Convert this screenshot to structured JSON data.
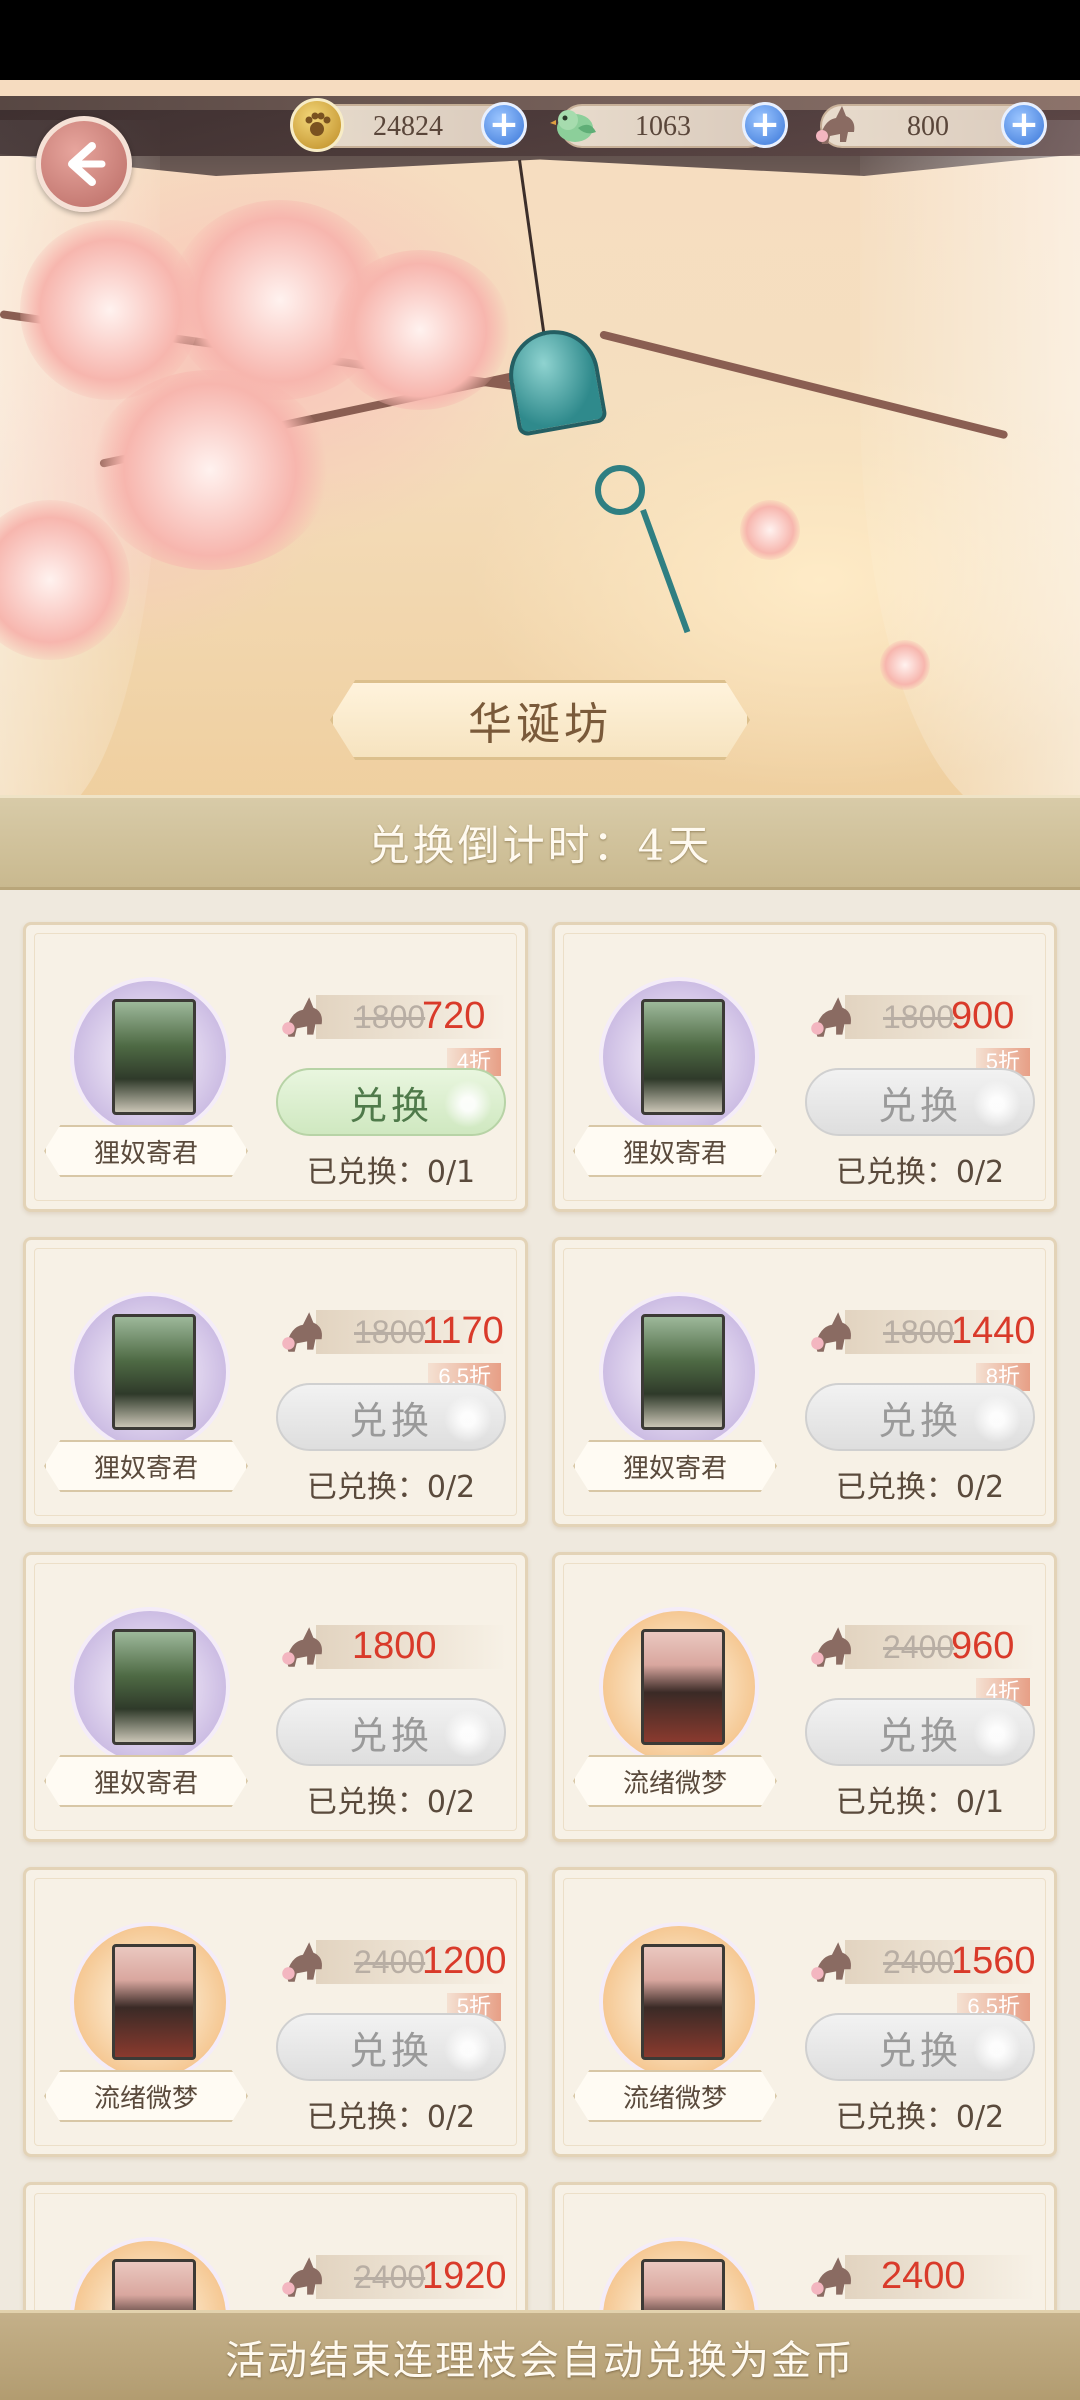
{
  "currencies": [
    {
      "icon": "paw-coin-icon",
      "value": "24824"
    },
    {
      "icon": "green-bird-icon",
      "value": "1063"
    },
    {
      "icon": "horse-token-icon",
      "value": "800"
    }
  ],
  "title": "华诞坊",
  "countdown": "兑换倒计时：4天",
  "items": [
    {
      "name": "狸奴寄君",
      "old_price": "1800",
      "price": "720",
      "discount": "4折",
      "button": "兑换",
      "button_state": "active",
      "redeemed": "已兑换：0/1",
      "theme": "purple"
    },
    {
      "name": "狸奴寄君",
      "old_price": "1800",
      "price": "900",
      "discount": "5折",
      "button": "兑换",
      "button_state": "disabled",
      "redeemed": "已兑换：0/2",
      "theme": "purple"
    },
    {
      "name": "狸奴寄君",
      "old_price": "1800",
      "price": "1170",
      "discount": "6.5折",
      "button": "兑换",
      "button_state": "disabled",
      "redeemed": "已兑换：0/2",
      "theme": "purple"
    },
    {
      "name": "狸奴寄君",
      "old_price": "1800",
      "price": "1440",
      "discount": "8折",
      "button": "兑换",
      "button_state": "disabled",
      "redeemed": "已兑换：0/2",
      "theme": "purple"
    },
    {
      "name": "狸奴寄君",
      "old_price": "",
      "price": "1800",
      "discount": "",
      "button": "兑换",
      "button_state": "disabled",
      "redeemed": "已兑换：0/2",
      "theme": "purple"
    },
    {
      "name": "流绪微梦",
      "old_price": "2400",
      "price": "960",
      "discount": "4折",
      "button": "兑换",
      "button_state": "disabled",
      "redeemed": "已兑换：0/1",
      "theme": "orange"
    },
    {
      "name": "流绪微梦",
      "old_price": "2400",
      "price": "1200",
      "discount": "5折",
      "button": "兑换",
      "button_state": "disabled",
      "redeemed": "已兑换：0/2",
      "theme": "orange"
    },
    {
      "name": "流绪微梦",
      "old_price": "2400",
      "price": "1560",
      "discount": "6.5折",
      "button": "兑换",
      "button_state": "disabled",
      "redeemed": "已兑换：0/2",
      "theme": "orange"
    },
    {
      "name": "",
      "old_price": "2400",
      "price": "1920",
      "discount": "",
      "button": "",
      "button_state": "hidden",
      "redeemed": "",
      "theme": "orange"
    },
    {
      "name": "",
      "old_price": "",
      "price": "2400",
      "discount": "",
      "button": "",
      "button_state": "hidden",
      "redeemed": "",
      "theme": "orange"
    }
  ],
  "footer_notice": "活动结束连理枝会自动兑换为金币",
  "colors": {
    "price_red": "#d93a2a",
    "active_button": "#cfe8c0",
    "plus_blue": "#4d86e0"
  }
}
